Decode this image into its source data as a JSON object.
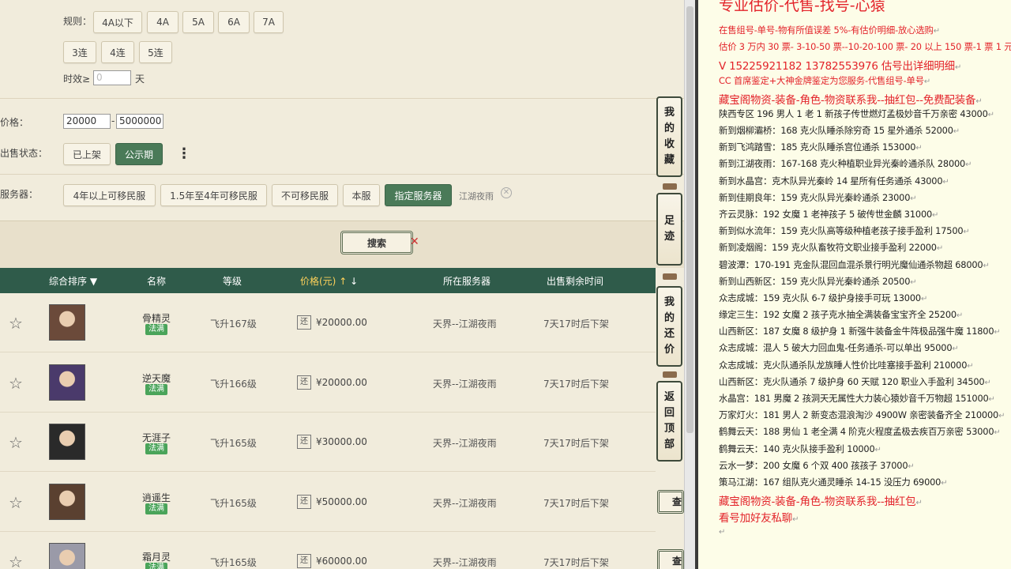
{
  "filters": {
    "rules_label": "规则：",
    "rules_options_row1": [
      "4A以下",
      "4A",
      "5A",
      "6A",
      "7A"
    ],
    "rules_options_row2": [
      "3连",
      "4连",
      "5连"
    ],
    "validity_label": "时效≥",
    "validity_placeholder": "0",
    "validity_unit": "天",
    "price_label": "价格：",
    "price_min": "20000",
    "price_sep": "-",
    "price_max": "5000000",
    "status_label": "出售状态：",
    "status_options": [
      "已上架",
      "公示期"
    ],
    "status_selected": "公示期",
    "server_label": "服务器：",
    "server_options": [
      "4年以上可移民服",
      "1.5年至4年可移民服",
      "不可移民服",
      "本服",
      "指定服务器"
    ],
    "server_selected": "指定服务器",
    "server_chip": "江湖夜雨",
    "search_button": "搜索"
  },
  "table": {
    "headers": {
      "sort": "综合排序",
      "name": "名称",
      "level": "等级",
      "price": "价格(元)",
      "server": "所在服务器",
      "remain": "出售剩余时间"
    },
    "rows": [
      {
        "name": "骨精灵",
        "badge": "法满",
        "level": "飞升167级",
        "haggle": "还",
        "price": "¥20000.00",
        "server": "天界--江湖夜雨",
        "remain": "7天17时后下架",
        "avatar_color": "#6b4a3a"
      },
      {
        "name": "逆天魔",
        "badge": "法满",
        "level": "飞升166级",
        "haggle": "还",
        "price": "¥20000.00",
        "server": "天界--江湖夜雨",
        "remain": "7天17时后下架",
        "avatar_color": "#4a3a6b"
      },
      {
        "name": "无涯子",
        "badge": "法满",
        "level": "飞升165级",
        "haggle": "还",
        "price": "¥30000.00",
        "server": "天界--江湖夜雨",
        "remain": "7天17时后下架",
        "avatar_color": "#2a2a2a"
      },
      {
        "name": "逍遥生",
        "badge": "法满",
        "level": "飞升165级",
        "haggle": "还",
        "price": "¥50000.00",
        "server": "天界--江湖夜雨",
        "remain": "7天17时后下架",
        "avatar_color": "#5a4030"
      },
      {
        "name": "霜月灵",
        "badge": "法满",
        "level": "飞升165级",
        "haggle": "还",
        "price": "¥60000.00",
        "server": "天界--江湖夜雨",
        "remain": "7天17时后下架",
        "avatar_color": "#9a9aa8"
      }
    ],
    "view_label": "查"
  },
  "side_tabs": [
    "我的收藏",
    "足迹",
    "我的还价",
    "返回顶部"
  ],
  "notes": {
    "title": "专业估价-代售-找号-心猿",
    "lines": [
      {
        "text": "在售组号-单号-物有所值误差 5%-有估价明细-放心选购",
        "red": true
      },
      {
        "text": "估价 3 万内 30 票- 3-10-50 票--10-20-100 票- 20 以上 150 票-1 票 1 元",
        "red": true
      },
      {
        "text": "V 15225921182    13782553976    估号出详细明细",
        "red": true,
        "big": true
      },
      {
        "text": "CC 首席鉴定+大神金牌鉴定为您服务-代售组号-单号",
        "red": true
      },
      {
        "text": "藏宝阁物资-装备-角色-物资联系我--抽红包--免费配装备",
        "red": true,
        "big": true
      },
      {
        "text": "陕西专区 196 男人 1 老 1 新孩子传世燃灯孟极妙音千万亲密 43000"
      },
      {
        "text": "新到烟柳灞桥：168 克火队睡杀除穷奇 15 星外通杀 52000"
      },
      {
        "text": "新到飞鸿踏雪：185 克火队睡杀宫位通杀 153000"
      },
      {
        "text": "新到江湖夜雨：167-168 克火种植职业异光秦岭通杀队 28000"
      },
      {
        "text": "新到水晶宫：克木队异光秦岭 14 星所有任务通杀 43000"
      },
      {
        "text": "新到佳期良年：159 克火队异光秦岭通杀 23000"
      },
      {
        "text": "齐云灵脉：192 女魔 1 老神孩子 5 破传世金麟 31000"
      },
      {
        "text": "新到似水流年：159 克火队高等级种植老孩子接手盈利 17500"
      },
      {
        "text": "新到凌烟阁：159 克火队畜牧符文职业接手盈利 22000"
      },
      {
        "text": "碧波潭：170-191 克金队混回血混杀景行明光魔仙通杀物超 68000"
      },
      {
        "text": "新到山西新区：159 克火队异光秦岭通杀 20500"
      },
      {
        "text": "众志成城：159 克火队 6-7 级护身接手可玩 13000"
      },
      {
        "text": "缘定三生：192 女魔 2 孩子克水抽全满装备宝宝齐全 25200"
      },
      {
        "text": "山西新区：187 女魔 8 级护身 1 新强牛装备金牛阵极品强牛魔 11800"
      },
      {
        "text": "众志成城：混人 5 破大力回血鬼-任务通杀-可以单出 95000"
      },
      {
        "text": "众志成城：克火队通杀队龙族睡人性价比哇塞接手盈利 210000"
      },
      {
        "text": "山西新区：克火队通杀 7 级护身 60 天赋 120 职业入手盈利 34500"
      },
      {
        "text": "水晶宫：181 男魔 2 孩洞天无属性大力装心猿妙音千万物超 151000"
      },
      {
        "text": "万家灯火：181 男人 2 新变态混浪淘沙 4900W 亲密装备齐全 210000"
      },
      {
        "text": "鹤舞云天：188 男仙 1 老全满 4 阶克火程度孟极去疾百万亲密 53000"
      },
      {
        "text": "鹤舞云天：140 克火队接手盈利 10000"
      },
      {
        "text": "云水一梦：200 女魔 6 个双 400 孩孩子 37000"
      },
      {
        "text": "策马江湖：167 组队克火通灵睡杀 14-15 没压力 69000"
      },
      {
        "text": "藏宝阁物资-装备-角色-物资联系我--抽红包",
        "red": true,
        "big": true
      },
      {
        "text": "看号加好友私聊",
        "red": true,
        "big": true
      },
      {
        "text": ""
      }
    ]
  }
}
